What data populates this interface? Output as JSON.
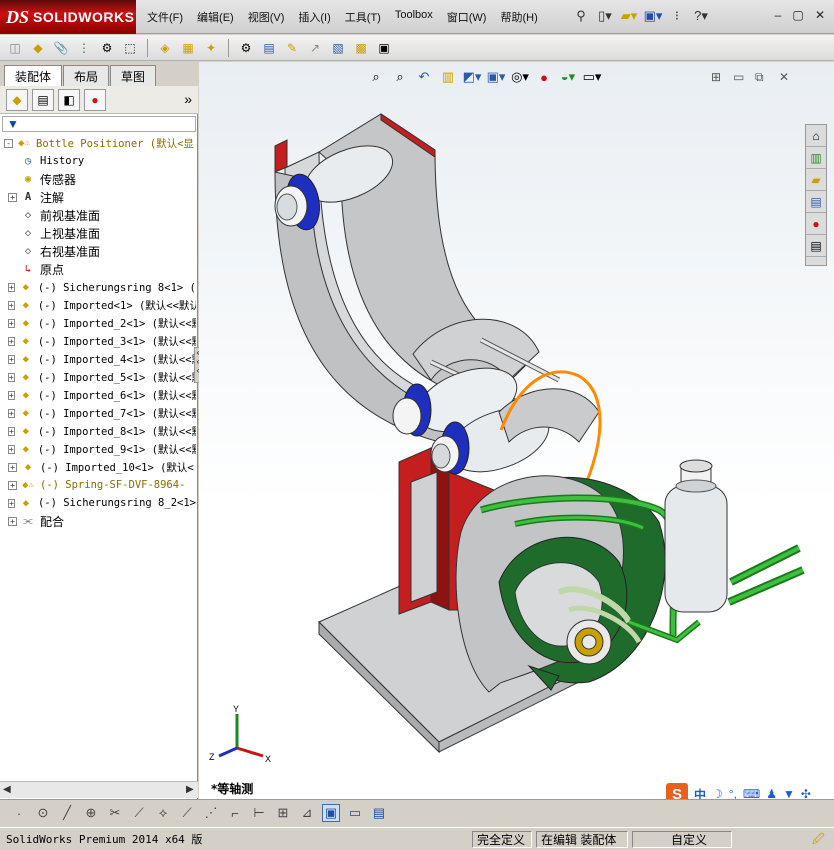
{
  "app": {
    "logo_prefix": "DS",
    "logo_name": "SOLIDWORKS"
  },
  "menu": [
    "文件(F)",
    "编辑(E)",
    "视图(V)",
    "插入(I)",
    "工具(T)",
    "Toolbox",
    "窗口(W)",
    "帮助(H)"
  ],
  "title_icons": [
    "pin-icon",
    "new-document-icon",
    "open-icon",
    "save-icon",
    "options-icon",
    "help-icon"
  ],
  "panel": {
    "tabs": [
      "装配体",
      "布局",
      "草图"
    ],
    "more": "»",
    "filter_icon": "filter-icon"
  },
  "tree": [
    {
      "label": "Bottle Positioner  (默认<显",
      "icon": "assembly-warning",
      "expand": "-",
      "level": 0,
      "warn": true
    },
    {
      "label": "History",
      "icon": "history",
      "expand": "",
      "level": 1
    },
    {
      "label": "传感器",
      "icon": "sensor",
      "expand": "",
      "level": 1
    },
    {
      "label": "注解",
      "icon": "annotation",
      "expand": "+",
      "level": 1
    },
    {
      "label": "前视基准面",
      "icon": "plane",
      "expand": "",
      "level": 1
    },
    {
      "label": "上视基准面",
      "icon": "plane",
      "expand": "",
      "level": 1
    },
    {
      "label": "右视基准面",
      "icon": "plane",
      "expand": "",
      "level": 1
    },
    {
      "label": "原点",
      "icon": "origin",
      "expand": "",
      "level": 1
    },
    {
      "label": "(-) Sicherungsring 8<1> (默",
      "icon": "part",
      "expand": "+",
      "level": 1
    },
    {
      "label": "(-) Imported<1> (默认<<默认",
      "icon": "part",
      "expand": "+",
      "level": 1
    },
    {
      "label": "(-) Imported_2<1> (默认<<默",
      "icon": "part",
      "expand": "+",
      "level": 1
    },
    {
      "label": "(-) Imported_3<1> (默认<<默",
      "icon": "part",
      "expand": "+",
      "level": 1
    },
    {
      "label": "(-) Imported_4<1> (默认<<默",
      "icon": "part",
      "expand": "+",
      "level": 1
    },
    {
      "label": "(-) Imported_5<1> (默认<<默",
      "icon": "part",
      "expand": "+",
      "level": 1
    },
    {
      "label": "(-) Imported_6<1> (默认<<默",
      "icon": "part",
      "expand": "+",
      "level": 1
    },
    {
      "label": "(-) Imported_7<1> (默认<<默",
      "icon": "part",
      "expand": "+",
      "level": 1
    },
    {
      "label": "(-) Imported_8<1> (默认<<默",
      "icon": "part",
      "expand": "+",
      "level": 1
    },
    {
      "label": "(-) Imported_9<1> (默认<<默",
      "icon": "part",
      "expand": "+",
      "level": 1
    },
    {
      "label": "(-) Imported_10<1> (默认<",
      "icon": "part",
      "expand": "+",
      "level": 1
    },
    {
      "label": "(-) Spring-SF-DVF-8964-",
      "icon": "part-warning",
      "expand": "+",
      "level": 1,
      "warn": true
    },
    {
      "label": "(-) Sicherungsring 8_2<1>",
      "icon": "part",
      "expand": "+",
      "level": 1
    },
    {
      "label": "配合",
      "icon": "mates",
      "expand": "+",
      "level": 1
    }
  ],
  "viewport": {
    "view_name": "*等轴测",
    "triad": {
      "x": "X",
      "y": "Y",
      "z": "Z"
    }
  },
  "status": {
    "app_version": "SolidWorks Premium 2014 x64 版",
    "definition": "完全定义",
    "editing": "在编辑 装配体",
    "units": "自定义",
    "units_arrow": "▲"
  },
  "ime": {
    "logo": "S",
    "lang": "中"
  },
  "colors": {
    "frame_red": "#c41e1e",
    "part_gray": "#cfd1d3",
    "mech_green": "#1f6b2c",
    "tube_green": "#3fbf3f",
    "ring_blue": "#1e2fbf",
    "spring_orange": "#ff8a00",
    "logo_red": "#c11111"
  }
}
